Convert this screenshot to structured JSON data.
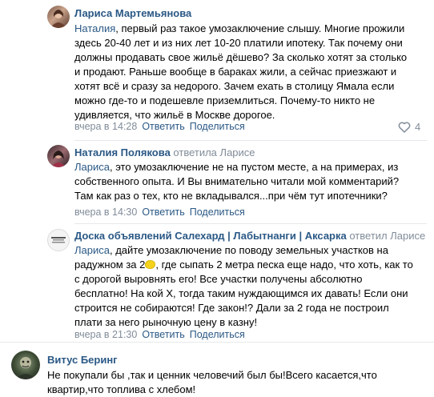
{
  "comments": [
    {
      "author": "Лариса Мартемьянова",
      "text": "Наталия, первый раз такое умозаключение слышу. Многие прожили\nздесь 20-40 лет и из них лет 10-20 платили ипотеку. Так почему они\nдолжны продавать свое жильё дёшево? За сколько хотят за столько\nи продают. Раньше вообще в бараках жили, а сейчас приезжают и\nхотят всё и сразу за недорого. Зачем ехать в столицу Ямала если\nможно где-то и подешевле приземлиться. Почему-то никто не\nудивляется, что жильё в Москве дорогое.",
      "mention": "Наталия",
      "time": "вчера в 14:28",
      "reply_label": "Ответить",
      "share_label": "Поделиться",
      "likes": "4"
    },
    {
      "author": "Наталия Полякова",
      "reply_prefix": "ответила",
      "reply_target": "Ларисе",
      "text": "Лариса, это умозаключение не на пустом месте, а на примерах, из\nсобственного опыта. И Вы внимательно читали мой комментарий?\nТам как раз о тех, кто не вкладывался...при чём тут ипотечники?",
      "mention": "Лариса",
      "time": "вчера в 14:30",
      "reply_label": "Ответить",
      "share_label": "Поделиться"
    },
    {
      "author": "Доска объявлений Салехард | Лабытнанги | Аксарка",
      "reply_prefix": "ответил",
      "reply_target": "Ларисе",
      "text_before": "Лариса, дайте умозаключение по поводу земельных участков на\nрадужном за 2",
      "text_after": ", где сыпать 2 метра песка еще надо, что хоть, как то\nс дорогой выровнять его! Все участки получены абсолютно\nбесплатно! На кой Х, тогда таким нуждающимся их давать! Если они\nстроится не собираются! Где закон!? Дали за 2 года не построил\nплати за него рыночную цену в казну!",
      "mention": "Лариса",
      "emoji": "lemon",
      "time": "вчера в 21:30",
      "reply_label": "Ответить",
      "share_label": "Поделиться"
    },
    {
      "author": "Витус Беринг",
      "text": "Не покупали бы ,так и ценник человечий был бы!Всего касается,что\nквартир,что топлива с хлебом!"
    }
  ],
  "icons": {
    "like": "heart-outline-icon"
  },
  "colors": {
    "link": "#2a5885",
    "meta": "#818c99",
    "separator": "#e7e8ec"
  }
}
